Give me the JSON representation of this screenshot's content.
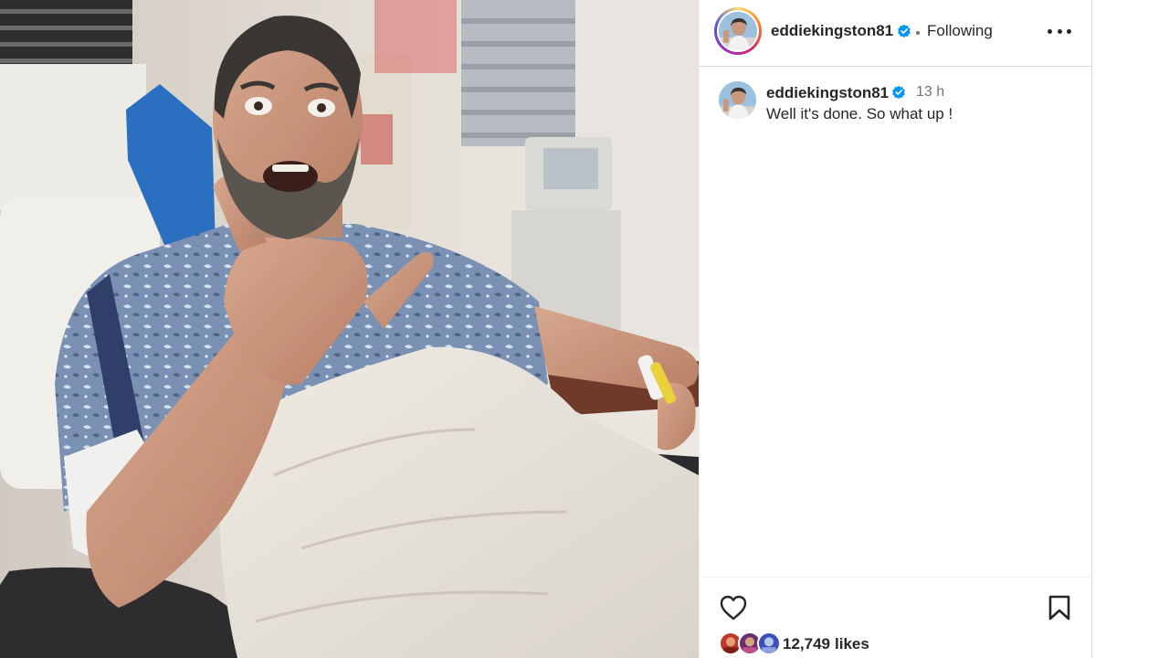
{
  "post": {
    "author": {
      "username": "eddiekingston81",
      "verified": true,
      "follow_status": "Following"
    },
    "caption": {
      "username": "eddiekingston81",
      "time_ago": "13 h",
      "text": "Well it's done. So what up !"
    },
    "photo": {
      "description_icon": "hospital-photo"
    },
    "likes": {
      "count": "12,749",
      "label": "likes"
    }
  },
  "icons": {
    "more": "more-options-icon",
    "like": "heart-icon",
    "save": "bookmark-icon",
    "verified": "verified-badge-icon"
  },
  "colors": {
    "verified_blue": "#0095f6",
    "text": "#262626",
    "muted": "#737373"
  }
}
